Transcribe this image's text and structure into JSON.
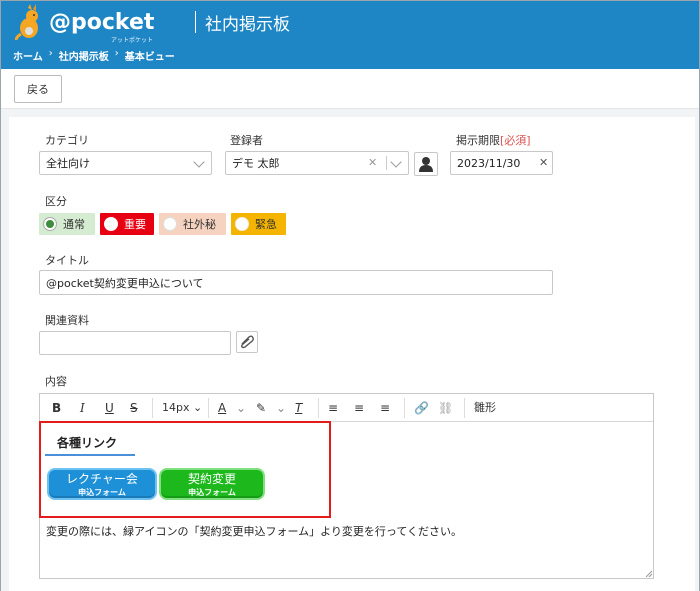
{
  "header": {
    "logo_text": "@pocket",
    "logo_sub": "アットポケット",
    "app_title": "社内掲示板",
    "breadcrumb": [
      "ホーム",
      "社内掲示板",
      "基本ビュー"
    ]
  },
  "toolbar": {
    "back_label": "戻る"
  },
  "form": {
    "category": {
      "label": "カテゴリ",
      "value": "全社向け"
    },
    "registrant": {
      "label": "登録者",
      "value": "デモ 太郎"
    },
    "deadline": {
      "label": "掲示期限",
      "required": "[必須]",
      "value": "2023/11/30"
    },
    "kubun": {
      "label": "区分",
      "options": [
        {
          "label": "通常",
          "color": "#d6ecd2",
          "selected": true
        },
        {
          "label": "重要",
          "color": "#e60012",
          "selected": false
        },
        {
          "label": "社外秘",
          "color": "#f6d3c0",
          "selected": false
        },
        {
          "label": "緊急",
          "color": "#f5b400",
          "selected": false
        }
      ]
    },
    "title": {
      "label": "タイトル",
      "value": "@pocket契約変更申込について"
    },
    "attachment": {
      "label": "関連資料",
      "value": ""
    },
    "content": {
      "label": "内容"
    }
  },
  "editor": {
    "font_size": "14px",
    "template_label": "雛形",
    "section_title": "各種リンク",
    "buttons": [
      {
        "main": "レクチャー会",
        "sub": "申込フォーム",
        "color": "#1e90d8"
      },
      {
        "main": "契約変更",
        "sub": "申込フォーム",
        "color": "#1cb81c"
      }
    ],
    "body_text": "変更の際には、緑アイコンの「契約変更申込フォーム」より変更を行ってください。"
  }
}
